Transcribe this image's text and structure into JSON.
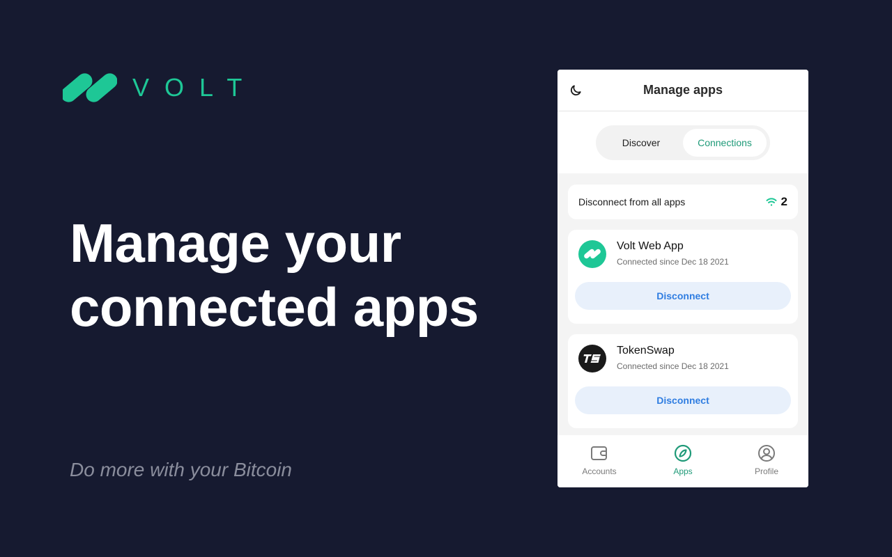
{
  "brand": {
    "name": "VOLT",
    "accent_color": "#1ec796"
  },
  "hero": {
    "headline_line1": "Manage your",
    "headline_line2": "connected apps",
    "tagline": "Do more with your Bitcoin"
  },
  "panel": {
    "header": {
      "title": "Manage apps",
      "theme_icon": "moon-icon"
    },
    "tabs": [
      {
        "label": "Discover",
        "active": false
      },
      {
        "label": "Connections",
        "active": true
      }
    ],
    "disconnect_all": {
      "label": "Disconnect from all apps",
      "icon": "wifi-icon",
      "count": "2"
    },
    "apps": [
      {
        "name": "Volt Web App",
        "since": "Connected since Dec 18 2021",
        "logo": "volt-logo-icon",
        "logo_color": "#1ec796",
        "action_label": "Disconnect"
      },
      {
        "name": "TokenSwap",
        "since": "Connected since Dec 18 2021",
        "logo": "tokenswap-logo-icon",
        "logo_color": "#1a1a1a",
        "action_label": "Disconnect"
      }
    ],
    "nav": [
      {
        "label": "Accounts",
        "icon": "wallet-icon",
        "active": false
      },
      {
        "label": "Apps",
        "icon": "compass-icon",
        "active": true
      },
      {
        "label": "Profile",
        "icon": "user-circle-icon",
        "active": false
      }
    ]
  }
}
